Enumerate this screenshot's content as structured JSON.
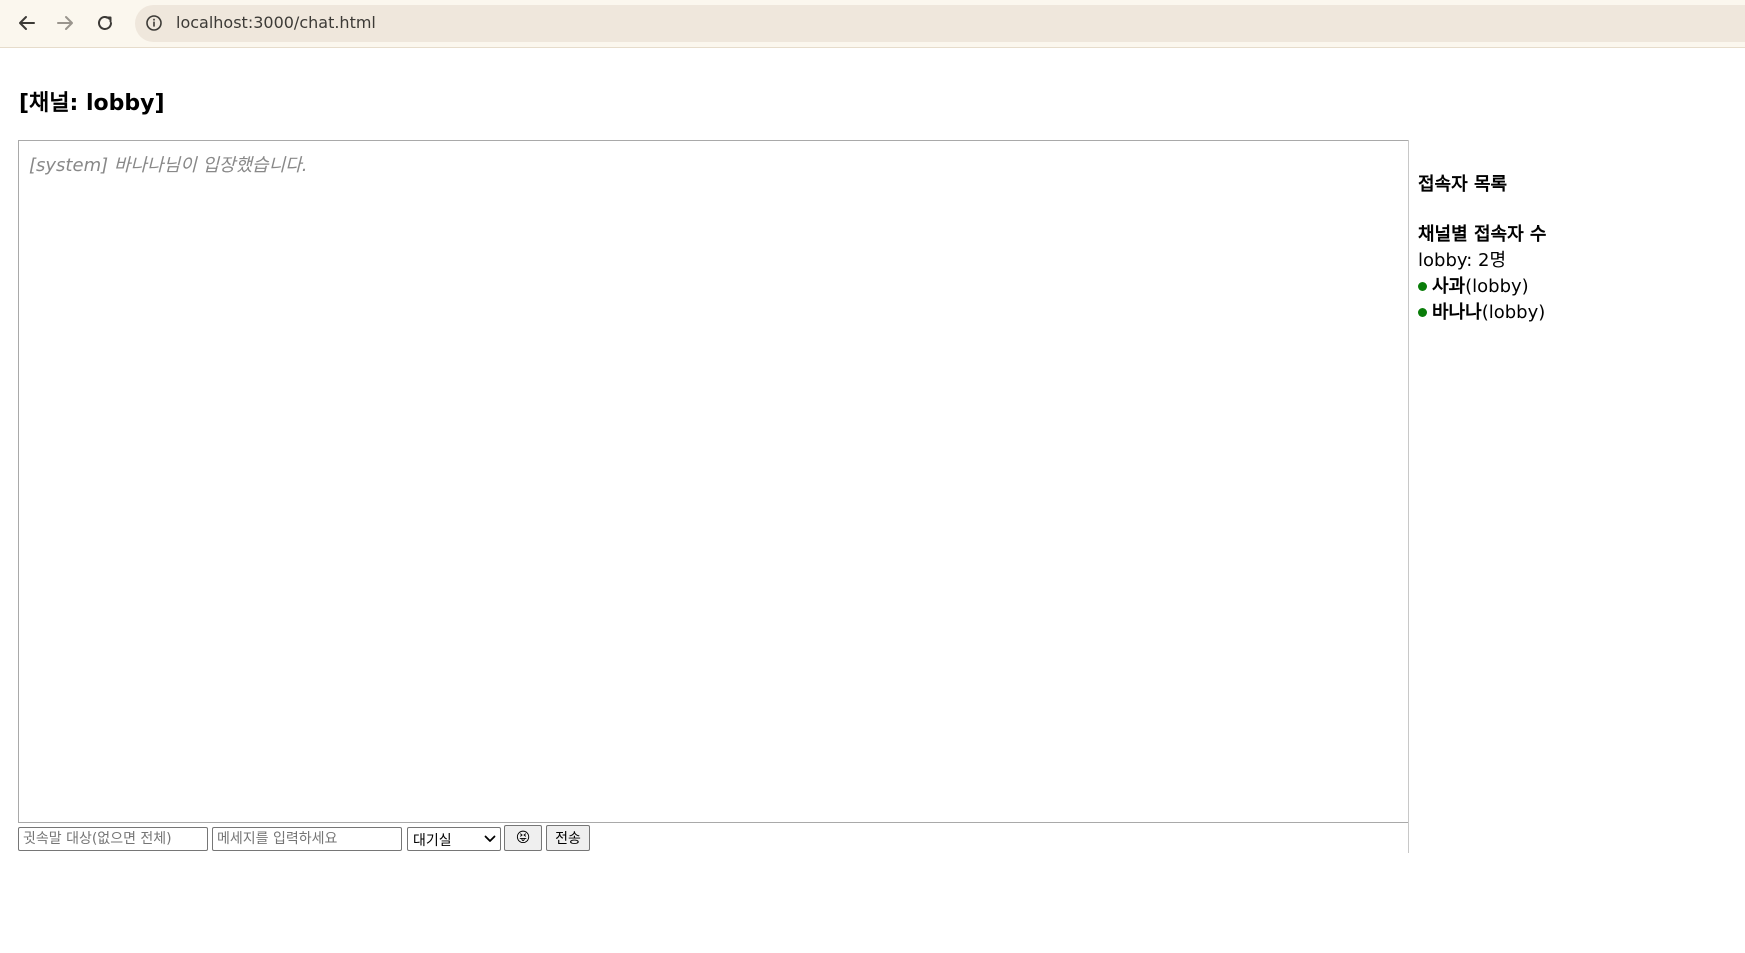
{
  "browser": {
    "url": "localhost:3000/chat.html"
  },
  "page": {
    "title": "[채널: lobby]"
  },
  "chat": {
    "messages": [
      {
        "text": "[system] 바나나님이 입장했습니다."
      }
    ]
  },
  "sidebar": {
    "users_heading": "접속자 목록",
    "channel_count_heading": "채널별 접속자 수",
    "channel_counts": [
      {
        "text": "lobby: 2명"
      }
    ],
    "users": [
      {
        "name": "사과",
        "channel": "(lobby)",
        "status_color": "#0a7d0a"
      },
      {
        "name": "바나나",
        "channel": "(lobby)",
        "status_color": "#0a7d0a"
      }
    ]
  },
  "input_bar": {
    "whisper_placeholder": "귓속말 대상(없으면 전체)",
    "message_placeholder": "메세지를 입력하세요",
    "channel_selected": "대기실",
    "emoji_label": "😝",
    "send_label": "전송"
  }
}
